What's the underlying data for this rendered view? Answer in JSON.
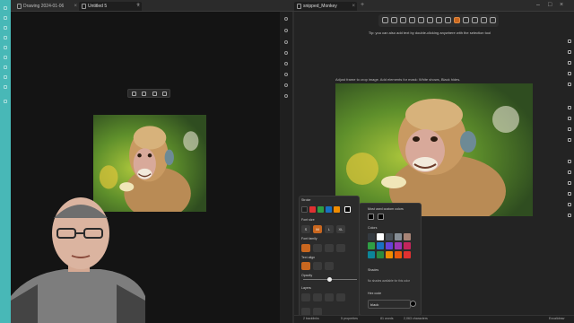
{
  "tabs": {
    "left": [
      {
        "label": "Drawing 2024-01-06 20.07..."
      },
      {
        "label": "Untitled 5"
      }
    ],
    "right": [
      {
        "label": "snipped_Monkey"
      }
    ]
  },
  "canvas": {
    "hint": "Tip: you can also add text by double-clicking anywhere with the selection tool",
    "frame_label": "Adjust frame to crop image. Add elements for mask: White shows, Black hides."
  },
  "properties": {
    "stroke_label": "Stroke",
    "font_size_label": "Font size",
    "font_sizes": [
      "S",
      "M",
      "L",
      "XL"
    ],
    "font_family_label": "Font family",
    "text_align_label": "Text align",
    "opacity_label": "Opacity",
    "opacity_value": 0.5,
    "layers_label": "Layers",
    "stroke_colors": [
      "#1e1e1e",
      "#e03131",
      "#2f9e44",
      "#1971c2",
      "#f08c00",
      "#ffffff"
    ]
  },
  "picker": {
    "most_used_label": "Most used custom colors",
    "colors_label": "Colors",
    "shades_label": "Shades",
    "shades_note": "No shades available for this color",
    "hex_label": "Hex code",
    "hex_value": "black",
    "palette": [
      "#343a40",
      "#ffffff",
      "#495057",
      "#868e96",
      "#a88476",
      "#2f9e44",
      "#1971c2",
      "#6741d9",
      "#9c36b5",
      "#c2255c",
      "#0c8599",
      "#2b8a3e",
      "#f08c00",
      "#e8590c",
      "#e03131"
    ]
  },
  "status": {
    "backlinks": "2 backlinks",
    "properties": "5 properties",
    "words": "81 words",
    "characters": "2,063 characters",
    "app": "Excalidraw"
  }
}
